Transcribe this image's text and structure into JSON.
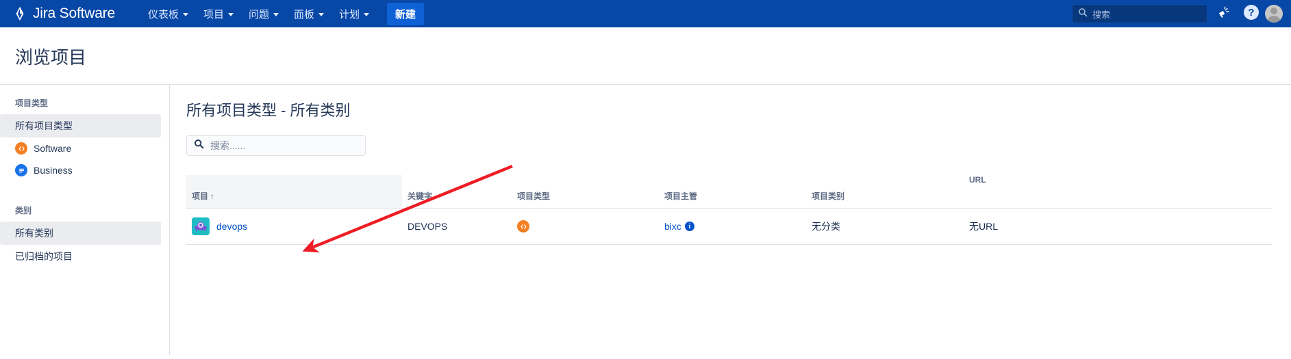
{
  "header": {
    "brand": "Jira Software",
    "brand_logo_icon": "jira-diamond-logo",
    "nav": [
      {
        "label": "仪表板",
        "icon": "chevron-down-icon"
      },
      {
        "label": "项目",
        "icon": "chevron-down-icon"
      },
      {
        "label": "问题",
        "icon": "chevron-down-icon"
      },
      {
        "label": "面板",
        "icon": "chevron-down-icon"
      },
      {
        "label": "计划",
        "icon": "chevron-down-icon"
      }
    ],
    "create_button": "新建",
    "search": {
      "placeholder": "搜索",
      "value": "",
      "icon": "search-icon"
    },
    "announcement_icon": "megaphone-icon",
    "help_icon": "help-question-icon",
    "avatar_icon": "user-avatar",
    "background_color": "#0747a6",
    "create_button_color": "#0f62d6"
  },
  "page": {
    "title": "浏览项目"
  },
  "sidebar": {
    "groups": [
      {
        "title": "项目类型",
        "items": [
          {
            "label": "所有项目类型",
            "selected": true,
            "icon": ""
          },
          {
            "label": "Software",
            "selected": false,
            "icon": "software-type-icon"
          },
          {
            "label": "Business",
            "selected": false,
            "icon": "business-type-icon"
          }
        ]
      },
      {
        "title": "类别",
        "items": [
          {
            "label": "所有类别",
            "selected": true,
            "icon": ""
          },
          {
            "label": "已归档的项目",
            "selected": false,
            "icon": ""
          }
        ]
      }
    ]
  },
  "main": {
    "title": "所有项目类型 - 所有类别",
    "filter_search": {
      "placeholder": "搜索......",
      "value": "",
      "icon": "search-icon"
    },
    "table": {
      "columns": [
        {
          "label": "项目",
          "sort": "↑",
          "shaded": true
        },
        {
          "label": "关键字",
          "sort": "",
          "shaded": false
        },
        {
          "label": "项目类型",
          "sort": "",
          "shaded": false
        },
        {
          "label": "项目主管",
          "sort": "",
          "shaded": false
        },
        {
          "label": "项目类别",
          "sort": "",
          "shaded": false
        },
        {
          "label": "URL",
          "sort": "",
          "shaded": false
        }
      ],
      "rows": [
        {
          "project_name": "devops",
          "project_avatar_icon": "devops-ufo-avatar",
          "key": "DEVOPS",
          "type_icon": "software-type-icon",
          "lead": "bixc",
          "lead_info_icon": "info-icon",
          "category": "无分类",
          "url": "无URL"
        }
      ]
    }
  },
  "annotation": {
    "arrow_color": "#ee1c25",
    "arrow_target": "devops-project-link"
  }
}
